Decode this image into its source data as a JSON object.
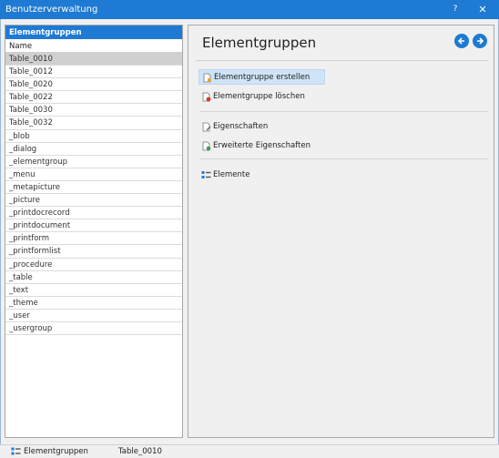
{
  "window": {
    "title": "Benutzerverwaltung",
    "help_label": "?",
    "close_label": "✕"
  },
  "left": {
    "header": "Elementgruppen",
    "column_header": "Name",
    "items": [
      "Table_0010",
      "Table_0012",
      "Table_0020",
      "Table_0022",
      "Table_0030",
      "Table_0032",
      "_blob",
      "_dialog",
      "_elementgroup",
      "_menu",
      "_metapicture",
      "_picture",
      "_printdocrecord",
      "_printdocument",
      "_printform",
      "_printformlist",
      "_procedure",
      "_table",
      "_text",
      "_theme",
      "_user",
      "_usergroup"
    ],
    "selected_index": 0
  },
  "right": {
    "title": "Elementgruppen",
    "actions": {
      "create": "Elementgruppe erstellen",
      "delete": "Elementgruppe löschen",
      "properties": "Eigenschaften",
      "extended_properties": "Erweiterte Eigenschaften",
      "elements": "Elemente"
    }
  },
  "status": {
    "label": "Elementgruppen",
    "value": "Table_0010"
  },
  "colors": {
    "accent": "#1e7ad3",
    "selected_row": "#d0d0d0",
    "highlight": "#cfe4f7"
  },
  "icons": {
    "create": "new-document-icon",
    "delete": "delete-document-icon",
    "properties": "edit-document-icon",
    "extended_properties": "settings-document-icon",
    "elements": "list-icon",
    "back": "back-arrow-icon",
    "forward": "forward-arrow-icon"
  }
}
